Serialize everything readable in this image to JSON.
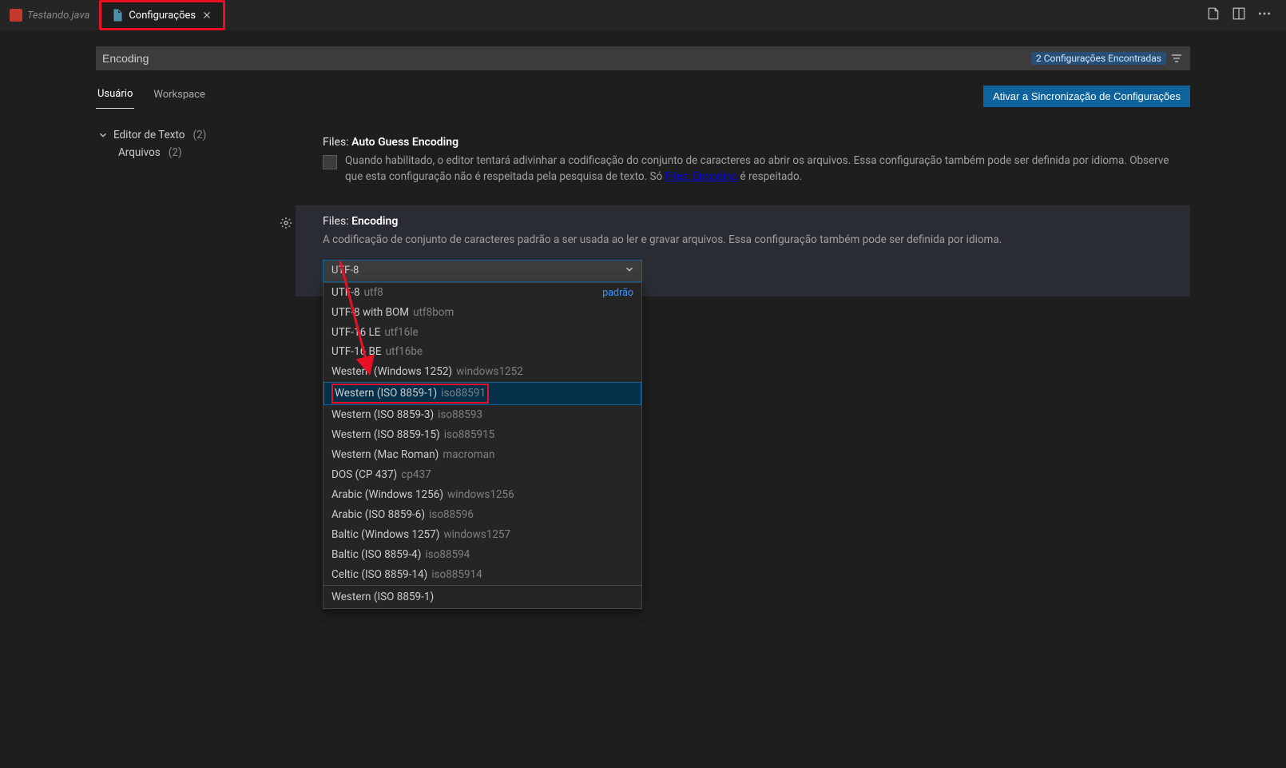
{
  "tabs": {
    "inactive_label": "Testando.java",
    "active_label": "Configurações"
  },
  "search": {
    "value": "Encoding",
    "results_badge": "2 Configurações Encontradas"
  },
  "scope": {
    "user": "Usuário",
    "workspace": "Workspace",
    "sync_button": "Ativar a Sincronização de Configurações"
  },
  "sidebar": {
    "root_label": "Editor de Texto",
    "root_count": "(2)",
    "child_label": "Arquivos",
    "child_count": "(2)"
  },
  "settings": {
    "auto_guess": {
      "title_prefix": "Files: ",
      "title_bold": "Auto Guess Encoding",
      "desc_part1": "Quando habilitado, o editor tentará adivinhar a codificação do conjunto de caracteres ao abrir os arquivos. Essa configuração também pode ser definida por idioma. Observe que esta configuração não é respeitada pela pesquisa de texto. Só ",
      "desc_link": "Files: Encoding",
      "desc_part2": " é respeitado."
    },
    "encoding": {
      "title_prefix": "Files: ",
      "title_bold": "Encoding",
      "desc": "A codificação de conjunto de caracteres padrão a ser usada ao ler e gravar arquivos. Essa configuração também pode ser definida por idioma.",
      "selected": "UTF-8",
      "dropdown_footer": "Western (ISO 8859-1)",
      "default_label": "padrão",
      "options": [
        {
          "label": "UTF-8",
          "id": "utf8",
          "default": true
        },
        {
          "label": "UTF-8 with BOM",
          "id": "utf8bom"
        },
        {
          "label": "UTF-16 LE",
          "id": "utf16le"
        },
        {
          "label": "UTF-16 BE",
          "id": "utf16be"
        },
        {
          "label": "Western (Windows 1252)",
          "id": "windows1252"
        },
        {
          "label": "Western (ISO 8859-1)",
          "id": "iso88591",
          "highlight": true
        },
        {
          "label": "Western (ISO 8859-3)",
          "id": "iso88593"
        },
        {
          "label": "Western (ISO 8859-15)",
          "id": "iso885915"
        },
        {
          "label": "Western (Mac Roman)",
          "id": "macroman"
        },
        {
          "label": "DOS (CP 437)",
          "id": "cp437"
        },
        {
          "label": "Arabic (Windows 1256)",
          "id": "windows1256"
        },
        {
          "label": "Arabic (ISO 8859-6)",
          "id": "iso88596"
        },
        {
          "label": "Baltic (Windows 1257)",
          "id": "windows1257"
        },
        {
          "label": "Baltic (ISO 8859-4)",
          "id": "iso88594"
        },
        {
          "label": "Celtic (ISO 8859-14)",
          "id": "iso885914"
        }
      ]
    }
  }
}
